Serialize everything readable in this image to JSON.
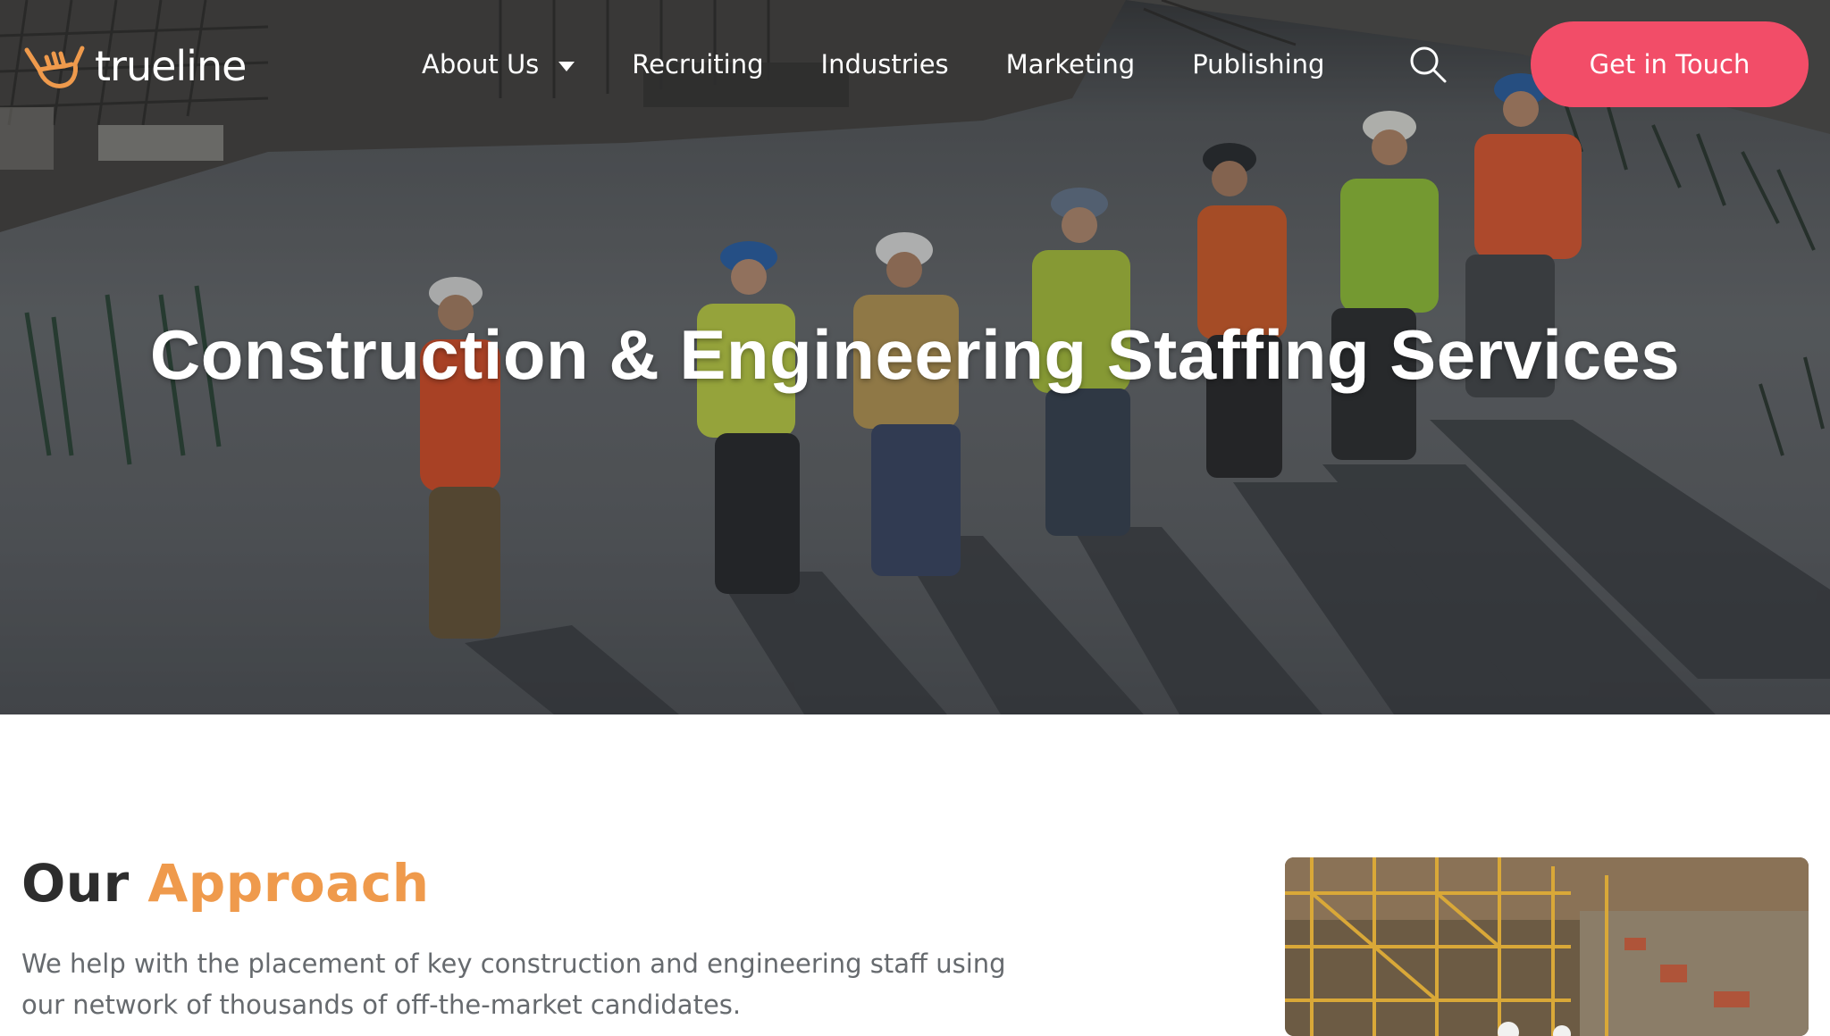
{
  "brand": {
    "name": "trueline",
    "logo_icon": "shaka-hand-icon",
    "accent_color": "#ef9a4c"
  },
  "nav": {
    "items": [
      {
        "label": "About Us",
        "has_dropdown": true
      },
      {
        "label": "Recruiting"
      },
      {
        "label": "Industries"
      },
      {
        "label": "Marketing"
      },
      {
        "label": "Publishing"
      }
    ],
    "search_icon": "search-icon",
    "cta_label": "Get in Touch",
    "cta_color": "#f24d68"
  },
  "hero": {
    "title": "Construction & Engineering Staffing Services"
  },
  "approach": {
    "title_part1": "Our",
    "title_part2": "Approach",
    "line1": "We help with the placement of key construction and engineering staff using",
    "line2": "our network of thousands of off-the-market candidates."
  }
}
